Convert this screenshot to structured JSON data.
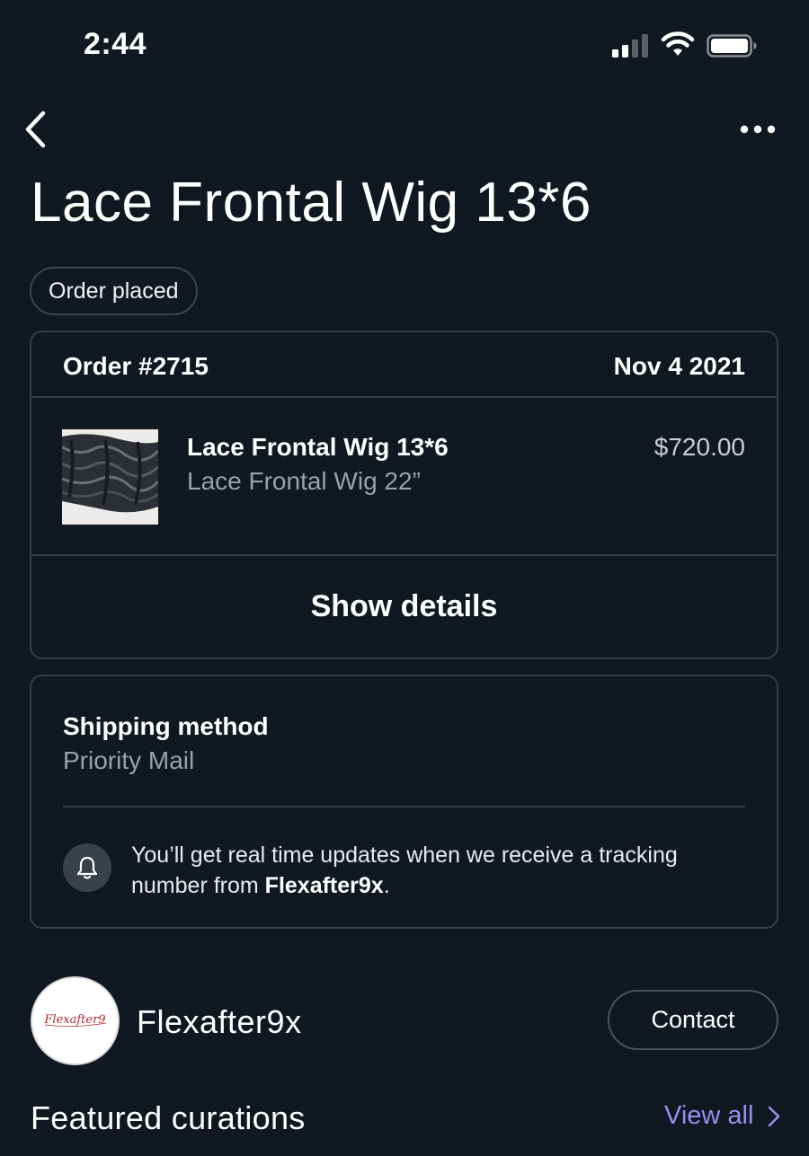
{
  "status_bar": {
    "time": "2:44",
    "icons": [
      "signal-icon",
      "wifi-icon",
      "battery-icon"
    ]
  },
  "nav": {
    "back_icon": "chevron-left-icon",
    "more_icon": "ellipsis-icon"
  },
  "page": {
    "title": "Lace Frontal Wig 13*6",
    "status_pill": "Order placed"
  },
  "order": {
    "number": "Order #2715",
    "date": "Nov 4 2021",
    "item": {
      "name": "Lace Frontal Wig 13*6",
      "variant": "Lace Frontal Wig 22”",
      "price": "$720.00"
    },
    "show_details_label": "Show details"
  },
  "shipping": {
    "label": "Shipping method",
    "value": "Priority Mail",
    "notice_prefix": "You’ll get real time updates when we receive a tracking number from ",
    "notice_seller": "Flexafter9x",
    "notice_suffix": ".",
    "notice_icon": "bell-icon"
  },
  "seller": {
    "name": "Flexafter9x",
    "logo_text": "Flexafter9",
    "contact_label": "Contact"
  },
  "featured": {
    "title": "Featured curations",
    "view_all_label": "View all"
  },
  "colors": {
    "background": "#121821",
    "border": "#363e49",
    "accent": "#9d8cf0",
    "muted_text": "#9aa1aa"
  }
}
